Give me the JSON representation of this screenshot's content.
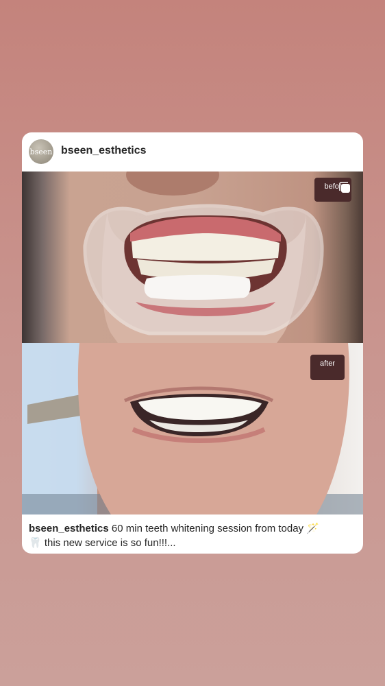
{
  "post": {
    "avatar_text": "bseen",
    "username": "bseen_esthetics",
    "before_label": "befor",
    "after_label": "after",
    "caption_user": "bseen_esthetics",
    "caption_text": "60 min teeth whitening session from today",
    "caption_emoji_1": "🪄",
    "caption_emoji_2": "🦷",
    "caption_text_2": "this new service is so fun!!!..."
  },
  "icons": {
    "copy": "copy-icon",
    "wand": "magic-wand-icon",
    "tooth": "tooth-icon"
  }
}
